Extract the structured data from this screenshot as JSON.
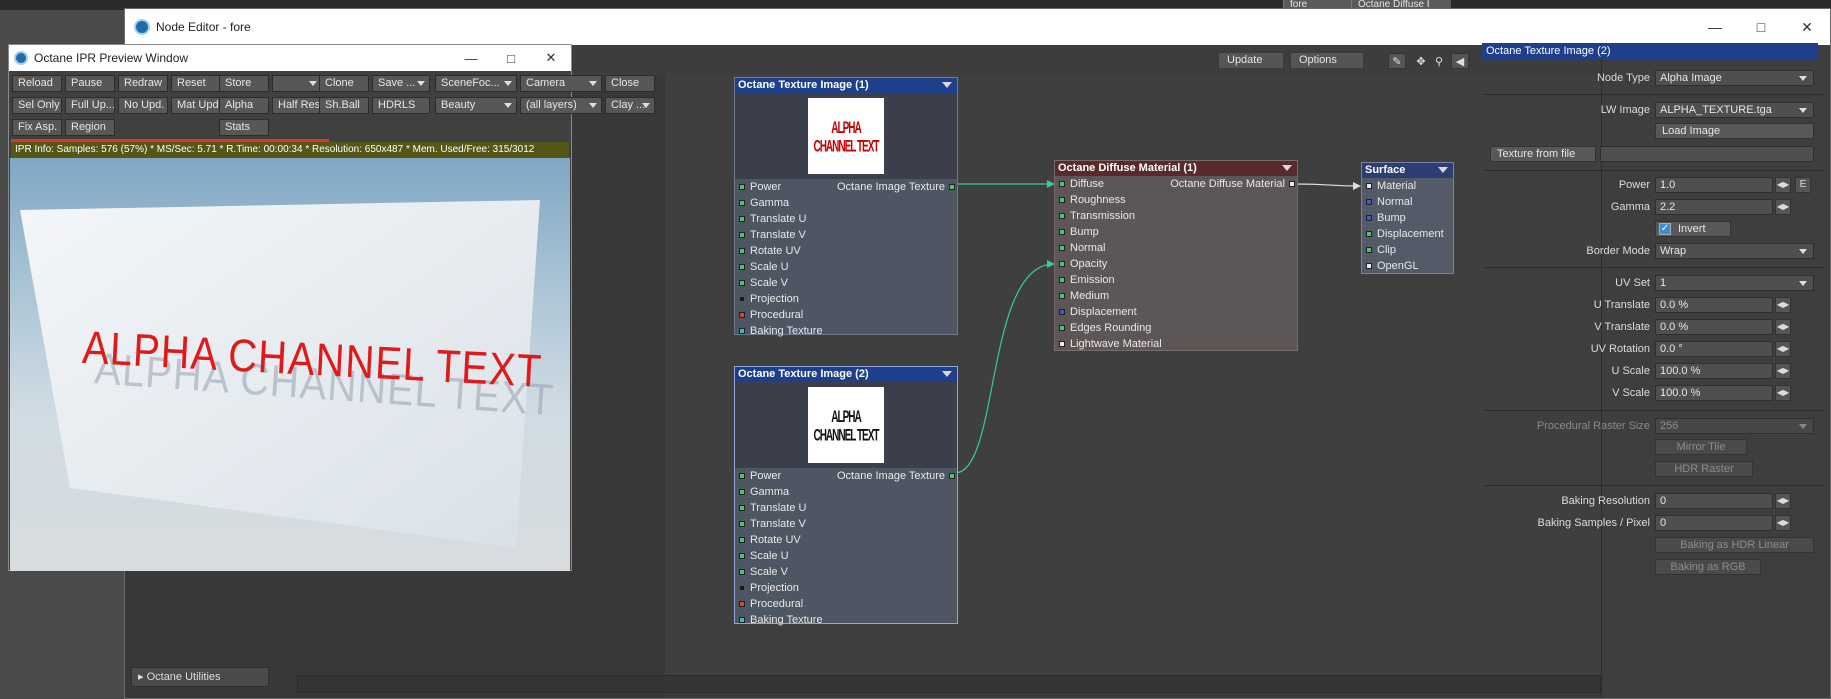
{
  "background": {
    "frag1": "fore",
    "frag2": "Octane Diffuse I"
  },
  "node_editor": {
    "title": "Node Editor - fore",
    "toolbar": {
      "update": "Update",
      "options": "Options"
    },
    "utility_item": "Octane Utilities"
  },
  "nodes": {
    "tex1": {
      "title": "Octane Texture Image (1)",
      "thumb_text": "ALPHA CHANNEL TEXT",
      "output": "Octane Image Texture",
      "inputs": [
        "Power",
        "Gamma",
        "Translate U",
        "Translate V",
        "Rotate UV",
        "Scale U",
        "Scale V",
        "Projection",
        "Procedural",
        "Baking Texture"
      ]
    },
    "tex2": {
      "title": "Octane Texture Image (2)",
      "thumb_text": "ALPHA CHANNEL TEXT",
      "output": "Octane Image Texture",
      "inputs": [
        "Power",
        "Gamma",
        "Translate U",
        "Translate V",
        "Rotate UV",
        "Scale U",
        "Scale V",
        "Projection",
        "Procedural",
        "Baking Texture"
      ]
    },
    "diffuse": {
      "title": "Octane Diffuse Material (1)",
      "output": "Octane Diffuse Material",
      "inputs": [
        "Diffuse",
        "Roughness",
        "Transmission",
        "Bump",
        "Normal",
        "Opacity",
        "Emission",
        "Medium",
        "Displacement",
        "Edges Rounding",
        "Lightwave Material"
      ]
    },
    "surface": {
      "title": "Surface",
      "inputs": [
        "Material",
        "Normal",
        "Bump",
        "Displacement",
        "Clip",
        "OpenGL"
      ]
    }
  },
  "properties": {
    "title": "Octane Texture Image (2)",
    "node_type_label": "Node Type",
    "node_type_value": "Alpha Image",
    "lw_image_label": "LW Image",
    "lw_image_value": "ALPHA_TEXTURE.tga",
    "load_image": "Load Image",
    "texture_from_file": "Texture from file",
    "power_label": "Power",
    "power_value": "1.0",
    "power_e": "E",
    "gamma_label": "Gamma",
    "gamma_value": "2.2",
    "invert_label": "Invert",
    "border_mode_label": "Border Mode",
    "border_mode_value": "Wrap",
    "uv_set_label": "UV Set",
    "uv_set_value": "1",
    "u_translate_label": "U Translate",
    "u_translate_value": "0.0 %",
    "v_translate_label": "V Translate",
    "v_translate_value": "0.0 %",
    "uv_rotation_label": "UV Rotation",
    "uv_rotation_value": "0.0 °",
    "u_scale_label": "U Scale",
    "u_scale_value": "100.0 %",
    "v_scale_label": "V Scale",
    "v_scale_value": "100.0 %",
    "raster_size_label": "Procedural Raster Size",
    "raster_size_value": "256",
    "mirror_tile": "Mirror Tile",
    "hdr_raster": "HDR Raster",
    "baking_resolution_label": "Baking Resolution",
    "baking_resolution_value": "0",
    "baking_samples_label": "Baking Samples / Pixel",
    "baking_samples_value": "0",
    "baking_hdr": "Baking as HDR Linear",
    "baking_rgb": "Baking as RGB"
  },
  "ipr": {
    "title": "Octane IPR Preview Window",
    "buttons": {
      "reload": "Reload",
      "pause": "Pause",
      "redraw": "Redraw",
      "reset": "Reset",
      "store": "Store",
      "store_drop": "",
      "clone": "Clone",
      "save": "Save ...",
      "scenefoc": "SceneFoc...",
      "camera": "Camera",
      "close": "Close",
      "selonly": "Sel Only",
      "fullup": "Full Up...",
      "noupd": "No Upd.",
      "matupd": "Mat Upd",
      "alpha": "Alpha",
      "halfres": "Half Res",
      "shball": "Sh.Ball",
      "hdrls": "HDRLS",
      "beauty": "Beauty",
      "alllayers": "(all layers)",
      "clay": "Clay ...",
      "fixasp": "Fix Asp.",
      "region": "Region",
      "stats": "Stats"
    },
    "info": "IPR Info:  Samples: 576 (57%)  *  MS/Sec: 5.71  *  R.Time: 00:00:34  *  Resolution: 650x487  *  Mem. Used/Free: 315/3012",
    "progress": 0.57,
    "render_text": "ALPHA CHANNEL TEXT"
  },
  "colors": {
    "node_header_selected": "#1e3f8c",
    "link": "#36c9a4",
    "info_bar": "#565616",
    "progress": "#dd3333"
  }
}
